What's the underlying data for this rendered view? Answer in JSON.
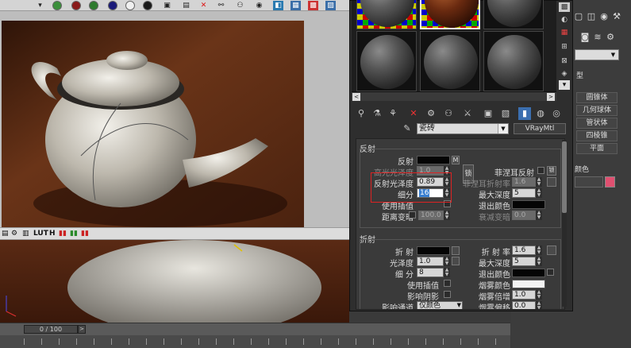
{
  "render_toolbar": {
    "labels": [
      "LUT",
      "H"
    ]
  },
  "timeline": {
    "frame_readout": "0 / 100",
    "next_label": ">"
  },
  "material_editor": {
    "material_name": "瓷砖",
    "material_type": "VRayMtl",
    "scroll_left": "<",
    "scroll_right": ">",
    "reflection": {
      "section_title": "反射",
      "reflect_label": "反射",
      "reflect_map_button": "M",
      "hilight_gloss_label": "高光光泽度",
      "hilight_gloss_value": "1.0",
      "lock_button": "锁",
      "fresnel_label": "菲涅耳反射",
      "fresnel_ior_label": "菲涅耳折射率",
      "fresnel_ior_value": "1.6",
      "fresnel_lock_button": "锁",
      "refl_gloss_label": "反射光泽度",
      "refl_gloss_value": "0.89",
      "subdivs_label": "细分",
      "subdivs_value": "16",
      "max_depth_label": "最大深度",
      "max_depth_value": "5",
      "use_interp_label": "使用插值",
      "exit_color_label": "退出颜色",
      "dim_distance_label": "距离变暗",
      "dim_distance_value": "100.0",
      "dim_falloff_label": "衰减变暗",
      "dim_falloff_value": "0.0"
    },
    "refraction": {
      "section_title": "折射",
      "refract_label": "折 射",
      "ior_label": "折 射 率",
      "ior_value": "1.6",
      "gloss_label": "光泽度",
      "gloss_value": "1.0",
      "max_depth_label": "最大深度",
      "max_depth_value": "5",
      "subdivs_label": "细 分",
      "subdivs_value": "8",
      "exit_color_label": "退出颜色",
      "use_interp_label": "使用插值",
      "fog_color_label": "烟雾颜色",
      "affect_shadows_label": "影响阴影",
      "fog_mult_label": "烟雾倍增",
      "fog_mult_value": "1.0",
      "affect_channels_label": "影响通道",
      "affect_channels_value": "仅颜色",
      "fog_bias_label": "烟雾偏移",
      "fog_bias_value": "0.0"
    }
  },
  "command_panel": {
    "section_label": "型",
    "buttons": [
      "圆锥体",
      "几何球体",
      "管状体",
      "四棱锥",
      "平面"
    ],
    "color_label": "颜色"
  },
  "colors": {
    "annotation": "#d22222",
    "swatch_black": "#050505",
    "swatch_white": "#f4f4f4",
    "object_color": "#e05070"
  }
}
